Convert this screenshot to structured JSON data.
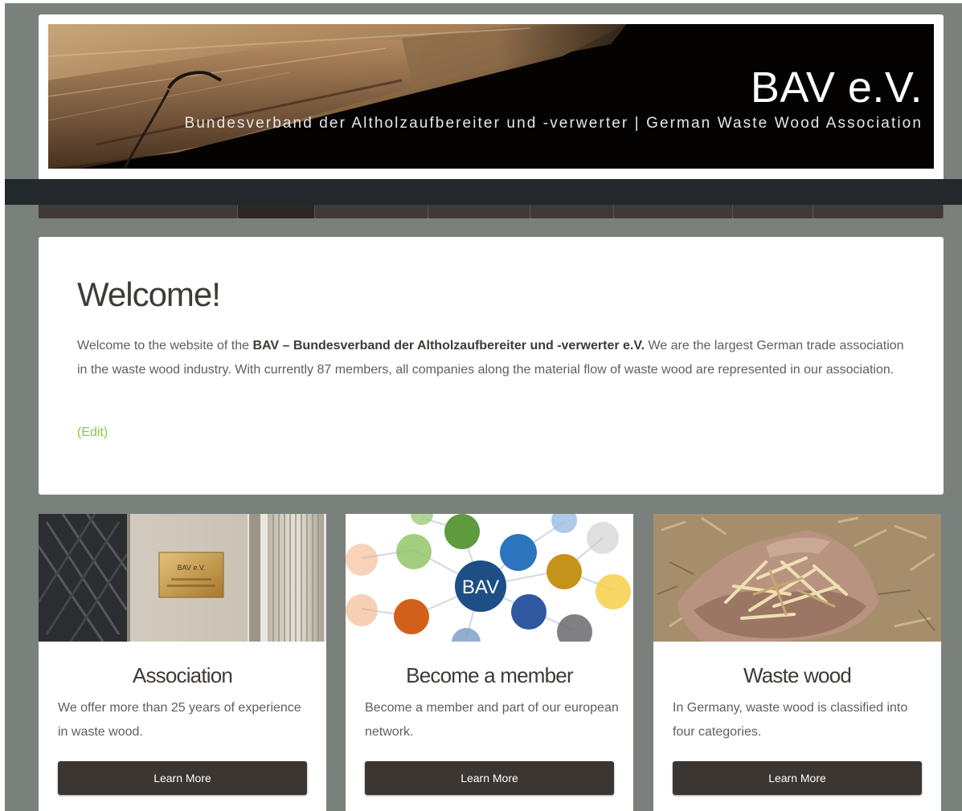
{
  "header": {
    "site_title": "BAV e.V.",
    "tagline": "Bundesverband der Altholzaufbereiter und -verwerter | German Waste Wood Association"
  },
  "nav": {
    "tab_count": 8,
    "active_index": 1
  },
  "welcome": {
    "title": "Welcome!",
    "intro": "Welcome to the website of the ",
    "org_name": "BAV – Bundesverband der Altholzaufbereiter und -verwerter e.V.",
    "body": " We are the largest German trade association in the waste wood industry. With currently 87 members, all companies along the material flow of waste wood are represented in our association.",
    "edit_link": "(Edit)"
  },
  "cards": [
    {
      "title": "Association",
      "text": "We offer more than 25 years of experience in waste wood.",
      "button": "Learn More",
      "plaque_text": "BAV e.V."
    },
    {
      "title": "Become a member",
      "text": "Become a member and part of our european network.",
      "button": "Learn More",
      "hub_label": "BAV"
    },
    {
      "title": "Waste wood",
      "text": "In Germany, waste wood is classified into four categories.",
      "button": "Learn More"
    }
  ],
  "colors": {
    "page_background": "#7a817d",
    "nav_bar": "#22282c",
    "button": "#3c3632",
    "link": "#8cc63f",
    "heading": "#3f3a36"
  }
}
